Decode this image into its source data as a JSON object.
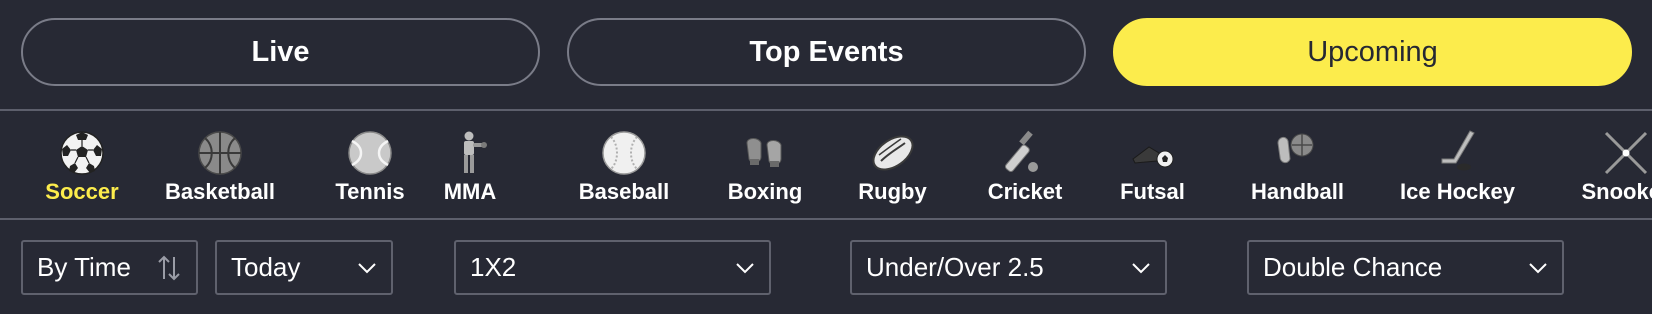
{
  "tabs": [
    {
      "label": "Live"
    },
    {
      "label": "Top Events"
    },
    {
      "label": "Upcoming"
    }
  ],
  "active_tab": "Upcoming",
  "sports": [
    {
      "label": "Soccer",
      "icon": "soccer-ball-icon"
    },
    {
      "label": "Basketball",
      "icon": "basketball-icon"
    },
    {
      "label": "Tennis",
      "icon": "tennis-ball-icon"
    },
    {
      "label": "MMA",
      "icon": "fighter-icon"
    },
    {
      "label": "Baseball",
      "icon": "baseball-icon"
    },
    {
      "label": "Boxing",
      "icon": "boxing-gloves-icon"
    },
    {
      "label": "Rugby",
      "icon": "rugby-ball-icon"
    },
    {
      "label": "Cricket",
      "icon": "cricket-bat-icon"
    },
    {
      "label": "Futsal",
      "icon": "futsal-shoe-icon"
    },
    {
      "label": "Handball",
      "icon": "handball-icon"
    },
    {
      "label": "Ice Hockey",
      "icon": "hockey-stick-icon"
    },
    {
      "label": "Snooker",
      "icon": "snooker-cues-icon"
    }
  ],
  "active_sport": "Soccer",
  "filters": {
    "sort": "By Time",
    "date": "Today",
    "market1": "1X2",
    "market2": "Under/Over 2.5",
    "market3": "Double Chance"
  },
  "colors": {
    "background": "#272934",
    "accent": "#fcec4c",
    "border": "#7a7c88"
  }
}
